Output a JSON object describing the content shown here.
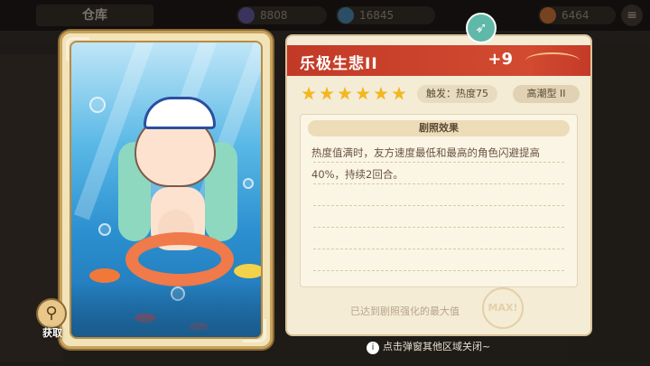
{
  "header": {
    "title": "仓库",
    "resources": [
      {
        "icon": "coin-icon",
        "value": "8808"
      },
      {
        "icon": "gem-icon",
        "value": "16845"
      },
      {
        "icon": "carrot-icon",
        "value": "6464"
      }
    ]
  },
  "card": {
    "get_label": "获取"
  },
  "detail": {
    "name": "乐极生悲II",
    "level": "+9",
    "stars": 6,
    "trigger": "触发：热度75",
    "type": "高潮型 II",
    "effect_title": "剧照效果",
    "effect_text": "热度值满时，友方速度最低和最高的角色闪避提高40%，持续2回合。",
    "max_note": "已达到剧照强化的最大值",
    "max_seal": "MAX!"
  },
  "footer": {
    "hint": "点击弹窗其他区域关闭~"
  },
  "colors": {
    "title_band": "#c23a27",
    "panel_bg": "#f5ecd6",
    "star": "#f5b81a",
    "rocket": "#5fb8a8"
  }
}
